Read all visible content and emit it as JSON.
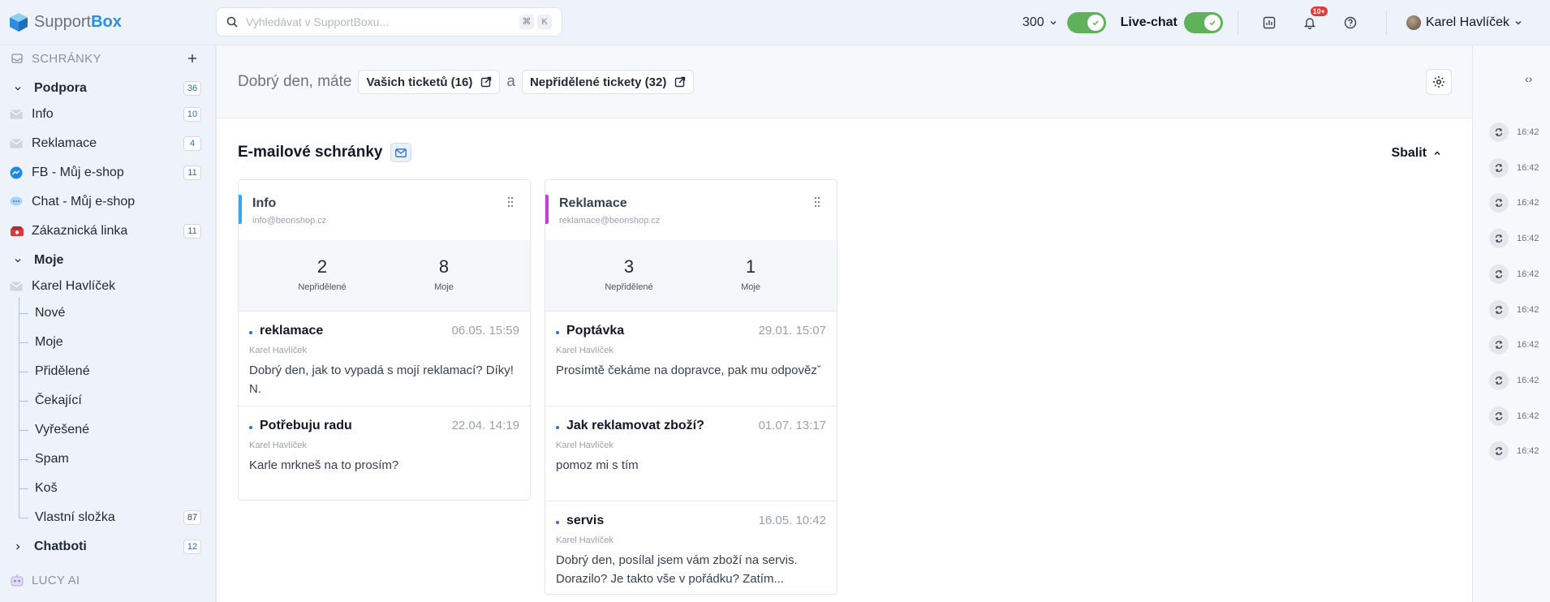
{
  "app": {
    "name_part1": "Support",
    "name_part2": "Box"
  },
  "search": {
    "placeholder": "Vyhledávat v SupportBoxu...",
    "kbd1": "⌘",
    "kbd2": "K"
  },
  "topbar": {
    "counter": "300",
    "live_chat_label": "Live-chat",
    "notifications_badge": "10+",
    "user_name": "Karel Havlíček"
  },
  "sidebar": {
    "section_inboxes": "SCHRÁNKY",
    "groups": [
      {
        "label": "Podpora",
        "count": "36"
      },
      {
        "label": "Moje"
      },
      {
        "label": "Chatboti",
        "count": "12"
      }
    ],
    "inboxes": [
      {
        "label": "Info",
        "count": "10"
      },
      {
        "label": "Reklamace",
        "count": "4"
      },
      {
        "label": "FB - Můj e-shop",
        "count": "11"
      },
      {
        "label": "Chat - Můj e-shop"
      },
      {
        "label": "Zákaznická linka",
        "count": "11"
      }
    ],
    "my_user": "Karel Havlíček",
    "folders": [
      {
        "label": "Nové"
      },
      {
        "label": "Moje"
      },
      {
        "label": "Přidělené"
      },
      {
        "label": "Čekající"
      },
      {
        "label": "Vyřešené"
      },
      {
        "label": "Spam"
      },
      {
        "label": "Koš"
      },
      {
        "label": "Vlastní složka",
        "count": "87"
      }
    ],
    "section_lucy": "LUCY AI"
  },
  "main": {
    "greeting": "Dobrý den, máte",
    "your_tickets": "Vašich ticketů (16)",
    "conjunction": "a",
    "unassigned_tickets": "Nepřidělené tickety (32)",
    "section_title": "E-mailové schránky",
    "collapse_label": "Sbalit",
    "cards": [
      {
        "title": "Info",
        "email": "info@beonshop.cz",
        "accent": "#38a6e8",
        "stats": [
          {
            "value": "2",
            "label": "Nepřidělené"
          },
          {
            "value": "8",
            "label": "Moje"
          }
        ],
        "messages": [
          {
            "subject": "reklamace",
            "time": "06.05. 15:59",
            "author": "Karel Havlíček",
            "body": "Dobrý den, jak to vypadá s mojí reklamací? Díky! N."
          },
          {
            "subject": "Potřebuju radu",
            "time": "22.04. 14:19",
            "author": "Karel Havlíček",
            "body": "Karle mrkneš na to prosím?"
          }
        ]
      },
      {
        "title": "Reklamace",
        "email": "reklamace@beonshop.cz",
        "accent": "#c13fd6",
        "stats": [
          {
            "value": "3",
            "label": "Nepřidělené"
          },
          {
            "value": "1",
            "label": "Moje"
          }
        ],
        "messages": [
          {
            "subject": "Poptávka",
            "time": "29.01. 15:07",
            "author": "Karel Havlíček",
            "body": "Prosímtě čekáme na dopravce, pak mu odpovězˇ"
          },
          {
            "subject": "Jak reklamovat zboží?",
            "time": "01.07. 13:17",
            "author": "Karel Havlíček",
            "body": "pomoz mi s tím"
          },
          {
            "subject": "servis",
            "time": "16.05. 10:42",
            "author": "Karel Havlíček",
            "body": "Dobrý den, posílal jsem vám zboží na servis. Dorazilo? Je takto vše v pořádku? Zatím..."
          }
        ]
      }
    ]
  },
  "rail": {
    "toggle": "‹›",
    "items": [
      "16:42",
      "16:42",
      "16:42",
      "16:42",
      "16:42",
      "16:42",
      "16:42",
      "16:42",
      "16:42",
      "16:42"
    ]
  },
  "colors": {
    "brand": "#2b8fe0",
    "toggle_on": "#5fb25a",
    "badge": "#e53935"
  }
}
